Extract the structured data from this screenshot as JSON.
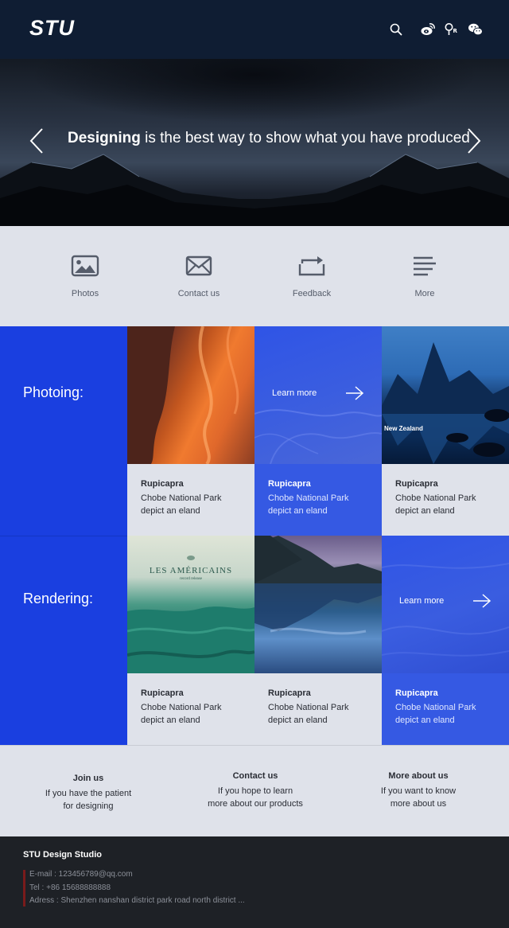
{
  "header": {
    "logo": "STU",
    "icons": [
      "search-icon",
      "weibo-icon",
      "people-icon",
      "wechat-icon"
    ]
  },
  "hero": {
    "title_strong": "Designing",
    "title_rest": " is the best way to show what you have produced"
  },
  "nav": {
    "items": [
      {
        "label": "Photos",
        "icon": "image-icon"
      },
      {
        "label": "Contact us",
        "icon": "mail-icon"
      },
      {
        "label": "Feedback",
        "icon": "repeat-icon"
      },
      {
        "label": "More",
        "icon": "menu-icon"
      }
    ]
  },
  "gallery": {
    "sections": [
      {
        "label": "Photoing:",
        "tiles": [
          {
            "kind": "photo",
            "caption_title": "Rupicapra",
            "caption_line1": "Chobe National Park",
            "caption_line2": "depict an eland"
          },
          {
            "kind": "learn",
            "learn_label": "Learn more",
            "caption_title": "Rupicapra",
            "caption_line1": "Chobe National Park",
            "caption_line2": "depict an eland"
          },
          {
            "kind": "photo",
            "photo_label": "New Zealand",
            "caption_title": "Rupicapra",
            "caption_line1": "Chobe National Park",
            "caption_line2": "depict an eland"
          }
        ]
      },
      {
        "label": "Rendering:",
        "tiles": [
          {
            "kind": "photo",
            "photo_title": "LES AMÉRICAINS",
            "photo_subtitle": "record release",
            "caption_title": "Rupicapra",
            "caption_line1": "Chobe National Park",
            "caption_line2": "depict an eland"
          },
          {
            "kind": "photo",
            "caption_title": "Rupicapra",
            "caption_line1": "Chobe National Park",
            "caption_line2": "depict an eland"
          },
          {
            "kind": "learn",
            "learn_label": "Learn more",
            "caption_title": "Rupicapra",
            "caption_line1": "Chobe National Park",
            "caption_line2": "depict an eland"
          }
        ]
      }
    ]
  },
  "info": {
    "columns": [
      {
        "title": "Join us",
        "line1": "If you have the patient",
        "line2": "for designing"
      },
      {
        "title": "Contact us",
        "line1": "If you hope to learn",
        "line2": "more about our products"
      },
      {
        "title": "More about us",
        "line1": "If you want to know",
        "line2": "more about us"
      }
    ]
  },
  "footer": {
    "title": "STU Design Studio",
    "email": "E-mail : 123456789@qq.com",
    "tel": "Tel : +86 15688888888",
    "address": "Adress : Shenzhen nanshan district park road north district ..."
  },
  "colors": {
    "header_bg": "#0f1d33",
    "section_blue": "#1a3fe0",
    "tile_blue": "#3559e3",
    "light_bg": "#dfe2ea",
    "footer_bg": "#1e2126"
  }
}
